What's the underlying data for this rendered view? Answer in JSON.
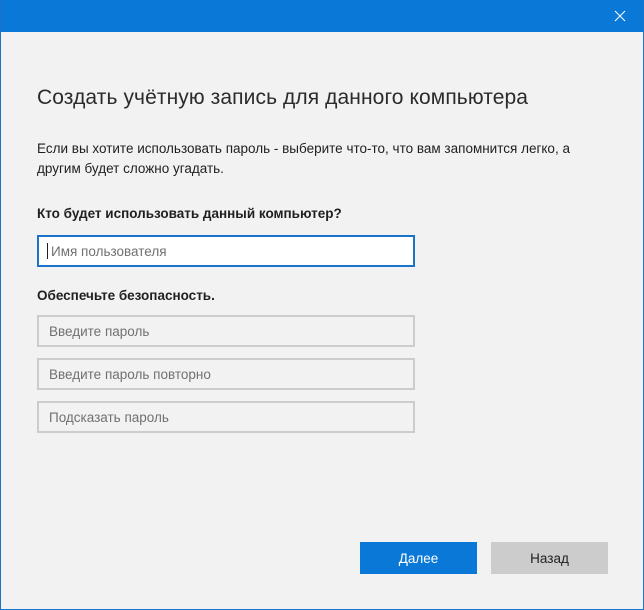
{
  "window": {
    "accent_color": "#0a78d7",
    "close_icon": "close-icon"
  },
  "page": {
    "title": "Создать учётную запись для данного компьютера",
    "description": "Если вы хотите использовать пароль - выберите что-то, что вам запомнится легко, а другим будет сложно угадать."
  },
  "who": {
    "label": "Кто будет использовать данный компьютер?",
    "username_placeholder": "Имя пользователя",
    "username_value": ""
  },
  "security": {
    "label": "Обеспечьте безопасность.",
    "password_placeholder": "Введите пароль",
    "password_repeat_placeholder": "Введите пароль повторно",
    "hint_placeholder": "Подсказать пароль"
  },
  "buttons": {
    "next_label": "Далее",
    "back_label": "Назад"
  }
}
